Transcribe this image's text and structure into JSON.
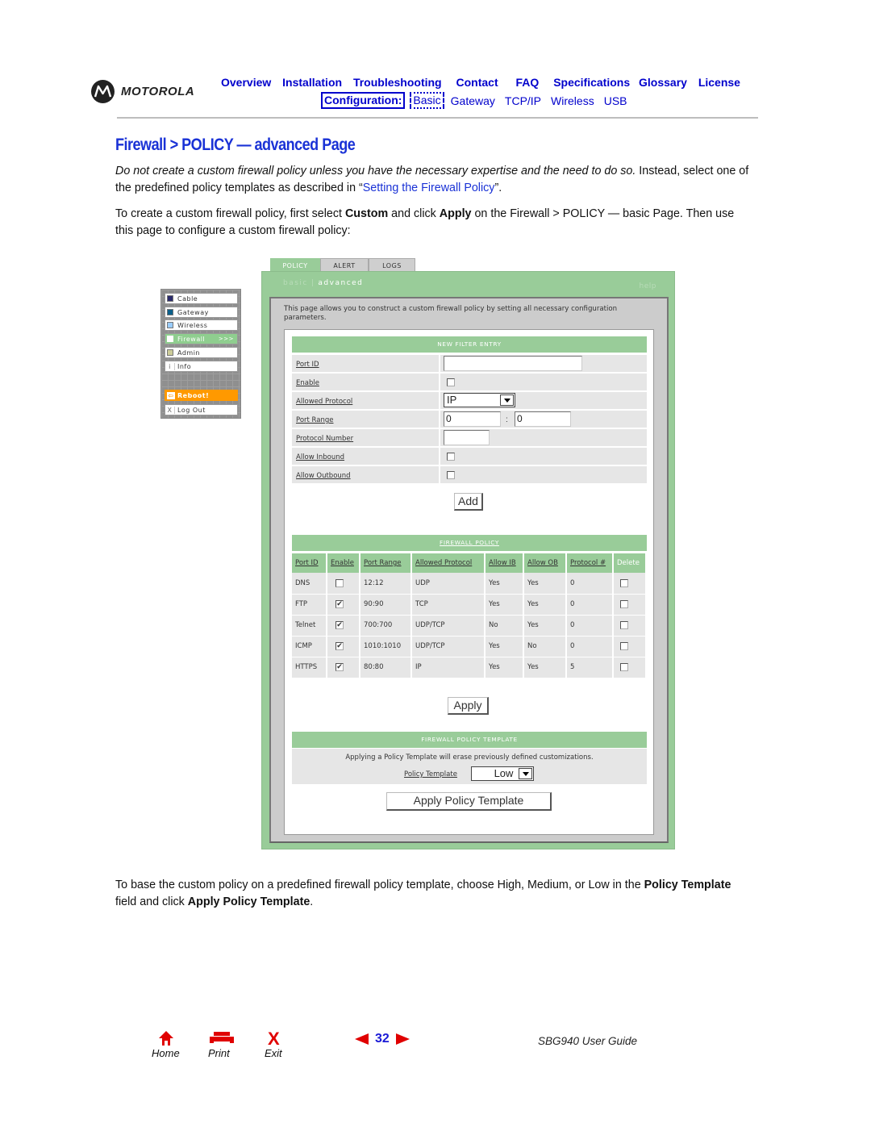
{
  "header": {
    "logo_text": "MOTOROLA",
    "top_nav": [
      "Overview",
      "Installation",
      "Troubleshooting",
      "Contact",
      "FAQ",
      "Specifications",
      "Glossary",
      "License"
    ],
    "sub_nav_label": "Configuration:",
    "sub_nav": [
      "Basic",
      "Gateway",
      "TCP/IP",
      "Wireless",
      "USB"
    ],
    "sub_nav_current": "Basic"
  },
  "page": {
    "title": "Firewall > POLICY — advanced Page",
    "p1_italic": "Do not create a custom firewall policy unless you have the necessary expertise and the need to do so.",
    "p1_rest": " Instead, select one of the predefined policy templates as described in “",
    "p1_link": "Setting the Firewall Policy",
    "p1_end": "”.",
    "p2_a": "To create a custom firewall policy, first select ",
    "p2_b": "Custom",
    "p2_c": " and click ",
    "p2_d": "Apply",
    "p2_e": " on the Firewall > POLICY — basic Page. Then use this page to configure a custom firewall policy:",
    "p3_a": "To base the custom policy on a predefined firewall policy template, choose High, Medium, or Low in the ",
    "p3_b": "Policy Template",
    "p3_c": " field and click ",
    "p3_d": "Apply Policy Template",
    "p3_e": "."
  },
  "left_menu": {
    "items": [
      {
        "label": "Cable",
        "color": "#2b2b6b"
      },
      {
        "label": "Gateway",
        "color": "#0b5f8a"
      },
      {
        "label": "Wireless",
        "color": "#99ccff"
      },
      {
        "label": "Firewall",
        "color": "#ffffff",
        "active": true,
        "suffix": ">>>"
      },
      {
        "label": "Admin",
        "color": "#cccc99"
      },
      {
        "label": "Info",
        "glyph": "i"
      },
      {
        "label": "Reboot!",
        "glyph": "⇦"
      },
      {
        "label": "Log Out",
        "glyph": "X"
      }
    ]
  },
  "app": {
    "tabs": [
      "POLICY",
      "ALERT",
      "LOGS"
    ],
    "active_tab": "POLICY",
    "subtabs": [
      "basic",
      "advanced"
    ],
    "active_subtab": "advanced",
    "help_label": "help",
    "intro": "This page allows you to construct a custom firewall policy by setting all necessary configuration parameters.",
    "new_filter": {
      "heading": "NEW FILTER ENTRY",
      "labels": {
        "port_id": "Port ID",
        "enable": "Enable",
        "allowed_protocol": "Allowed Protocol",
        "port_range": "Port Range",
        "protocol_number": "Protocol Number",
        "allow_inbound": "Allow Inbound",
        "allow_outbound": "Allow Outbound"
      },
      "values": {
        "port_id": "",
        "enable": false,
        "allowed_protocol": "IP",
        "port_range_start": "0",
        "port_range_end": "0",
        "protocol_number": "",
        "allow_inbound": false,
        "allow_outbound": false
      },
      "add_label": "Add"
    },
    "policy": {
      "heading": "FIREWALL POLICY",
      "columns": [
        "Port ID",
        "Enable",
        "Port Range",
        "Allowed Protocol",
        "Allow IB",
        "Allow OB",
        "Protocol #",
        "Delete"
      ],
      "rows": [
        {
          "port_id": "DNS",
          "enable": false,
          "port_range": "12:12",
          "protocol": "UDP",
          "allow_ib": "Yes",
          "allow_ob": "Yes",
          "proto_num": "0",
          "delete": false
        },
        {
          "port_id": "FTP",
          "enable": true,
          "port_range": "90:90",
          "protocol": "TCP",
          "allow_ib": "Yes",
          "allow_ob": "Yes",
          "proto_num": "0",
          "delete": false
        },
        {
          "port_id": "Telnet",
          "enable": true,
          "port_range": "700:700",
          "protocol": "UDP/TCP",
          "allow_ib": "No",
          "allow_ob": "Yes",
          "proto_num": "0",
          "delete": false
        },
        {
          "port_id": "ICMP",
          "enable": true,
          "port_range": "1010:1010",
          "protocol": "UDP/TCP",
          "allow_ib": "Yes",
          "allow_ob": "No",
          "proto_num": "0",
          "delete": false
        },
        {
          "port_id": "HTTPS",
          "enable": true,
          "port_range": "80:80",
          "protocol": "IP",
          "allow_ib": "Yes",
          "allow_ob": "Yes",
          "proto_num": "5",
          "delete": false
        }
      ],
      "apply_label": "Apply"
    },
    "template": {
      "heading": "FIREWALL POLICY TEMPLATE",
      "note": "Applying a Policy Template will erase previously defined customizations.",
      "label": "Policy Template",
      "value": "Low",
      "apply_label": "Apply Policy Template"
    }
  },
  "footer": {
    "home": "Home",
    "print": "Print",
    "exit": "Exit",
    "page_number": "32",
    "guide": "SBG940 User Guide"
  }
}
